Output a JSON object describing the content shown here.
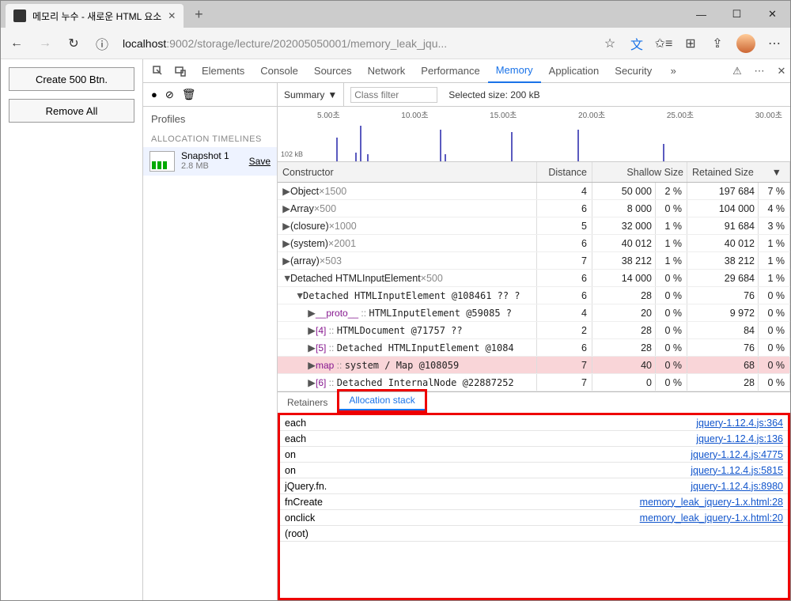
{
  "browser": {
    "tab_title": "메모리 누수 - 새로운 HTML 요소",
    "url_prefix": "localhost",
    "url_rest": ":9002/storage/lecture/202005050001/memory_leak_jqu..."
  },
  "page_buttons": {
    "create": "Create 500 Btn.",
    "remove": "Remove All"
  },
  "devtools": {
    "tabs": [
      "Elements",
      "Console",
      "Sources",
      "Network",
      "Performance",
      "Memory",
      "Application",
      "Security"
    ],
    "active_tab": "Memory",
    "more": "»"
  },
  "profiles": {
    "label": "Profiles",
    "section": "ALLOCATION TIMELINES",
    "snapshot": {
      "name": "Snapshot 1",
      "size": "2.8 MB",
      "save": "Save"
    }
  },
  "heap": {
    "summary_label": "Summary",
    "filter_placeholder": "Class filter",
    "selected_size": "Selected size: 200 kB",
    "timeline_ticks": [
      "5.00초",
      "10.00초",
      "15.00초",
      "20.00초",
      "25.00초",
      "30.00초"
    ],
    "timeline_ylabel": "102 kB",
    "columns": {
      "constructor": "Constructor",
      "distance": "Distance",
      "shallow": "Shallow Size",
      "retained": "Retained Size"
    },
    "rows": [
      {
        "indent": 0,
        "arrow": "▶",
        "text": "Object",
        "mult": "×1500",
        "distance": "4",
        "shallow": "50 000",
        "shallow_pct": "2 %",
        "retained": "197 684",
        "retained_pct": "7 %"
      },
      {
        "indent": 0,
        "arrow": "▶",
        "text": "Array",
        "mult": "×500",
        "distance": "6",
        "shallow": "8 000",
        "shallow_pct": "0 %",
        "retained": "104 000",
        "retained_pct": "4 %"
      },
      {
        "indent": 0,
        "arrow": "▶",
        "text": "(closure)",
        "mult": "×1000",
        "distance": "5",
        "shallow": "32 000",
        "shallow_pct": "1 %",
        "retained": "91 684",
        "retained_pct": "3 %"
      },
      {
        "indent": 0,
        "arrow": "▶",
        "text": "(system)",
        "mult": "×2001",
        "distance": "6",
        "shallow": "40 012",
        "shallow_pct": "1 %",
        "retained": "40 012",
        "retained_pct": "1 %"
      },
      {
        "indent": 0,
        "arrow": "▶",
        "text": "(array)",
        "mult": "×503",
        "distance": "7",
        "shallow": "38 212",
        "shallow_pct": "1 %",
        "retained": "38 212",
        "retained_pct": "1 %"
      },
      {
        "indent": 0,
        "arrow": "▼",
        "text": "Detached HTMLInputElement",
        "mult": "×500",
        "distance": "6",
        "shallow": "14 000",
        "shallow_pct": "0 %",
        "retained": "29 684",
        "retained_pct": "1 %"
      },
      {
        "indent": 1,
        "arrow": "▼",
        "text": "Detached HTMLInputElement @108461 ?? ?",
        "mult": "",
        "mono": true,
        "distance": "6",
        "shallow": "28",
        "shallow_pct": "0 %",
        "retained": "76",
        "retained_pct": "0 %"
      },
      {
        "indent": 2,
        "arrow": "▶",
        "text": "__proto__ :: HTMLInputElement @59085 ?",
        "mult": "",
        "mono": true,
        "proto": true,
        "distance": "4",
        "shallow": "20",
        "shallow_pct": "0 %",
        "retained": "9 972",
        "retained_pct": "0 %"
      },
      {
        "indent": 2,
        "arrow": "▶",
        "text": "[4] :: HTMLDocument @71757 ??",
        "mult": "",
        "mono": true,
        "distance": "2",
        "shallow": "28",
        "shallow_pct": "0 %",
        "retained": "84",
        "retained_pct": "0 %"
      },
      {
        "indent": 2,
        "arrow": "▶",
        "text": "[5] :: Detached HTMLInputElement @1084",
        "mult": "",
        "mono": true,
        "distance": "6",
        "shallow": "28",
        "shallow_pct": "0 %",
        "retained": "76",
        "retained_pct": "0 %"
      },
      {
        "indent": 2,
        "arrow": "▶",
        "text": "map :: system / Map @108059",
        "mult": "",
        "mono": true,
        "highlight": true,
        "distance": "7",
        "shallow": "40",
        "shallow_pct": "0 %",
        "retained": "68",
        "retained_pct": "0 %"
      },
      {
        "indent": 2,
        "arrow": "▶",
        "text": "[6] :: Detached InternalNode @22887252",
        "mult": "",
        "mono": true,
        "distance": "7",
        "shallow": "0",
        "shallow_pct": "0 %",
        "retained": "28",
        "retained_pct": "0 %"
      }
    ]
  },
  "bottom_tabs": {
    "retainers": "Retainers",
    "allocation_stack": "Allocation stack"
  },
  "stack": [
    {
      "fn": "each",
      "link": "jquery-1.12.4.js:364"
    },
    {
      "fn": "each",
      "link": "jquery-1.12.4.js:136"
    },
    {
      "fn": "on",
      "link": "jquery-1.12.4.js:4775"
    },
    {
      "fn": "on",
      "link": "jquery-1.12.4.js:5815"
    },
    {
      "fn": "jQuery.fn.<computed>",
      "link": "jquery-1.12.4.js:8980"
    },
    {
      "fn": "fnCreate",
      "link": "memory_leak_jquery-1.x.html:28"
    },
    {
      "fn": "onclick",
      "link": "memory_leak_jquery-1.x.html:20"
    },
    {
      "fn": "(root)",
      "link": ""
    }
  ]
}
